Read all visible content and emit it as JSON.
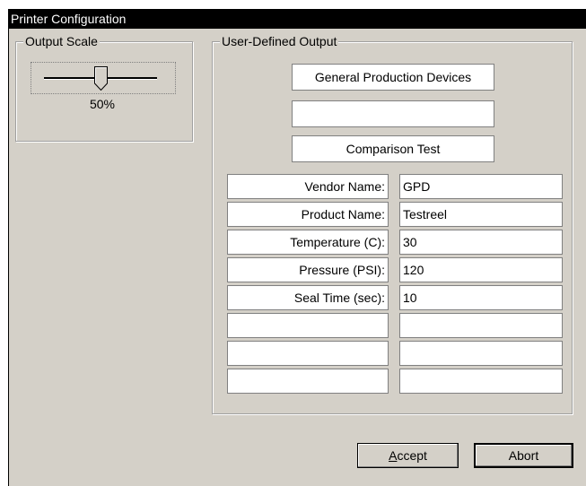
{
  "window": {
    "title": "Printer Configuration"
  },
  "output_scale": {
    "label": "Output Scale",
    "value": "50%",
    "level_percent": 50
  },
  "user_defined_output": {
    "label": "User-Defined Output",
    "header_lines": [
      "General Production Devices",
      "",
      "Comparison Test"
    ],
    "rows": [
      {
        "label": "Vendor Name:",
        "value": "GPD"
      },
      {
        "label": "Product Name:",
        "value": "Testreel"
      },
      {
        "label": "Temperature (C):",
        "value": "30"
      },
      {
        "label": "Pressure (PSI):",
        "value": "120"
      },
      {
        "label": "Seal Time (sec):",
        "value": "10"
      },
      {
        "label": "",
        "value": ""
      },
      {
        "label": "",
        "value": ""
      },
      {
        "label": "",
        "value": ""
      }
    ]
  },
  "buttons": {
    "accept_mnemonic": "A",
    "accept_rest": "ccept",
    "abort": "Abort"
  }
}
